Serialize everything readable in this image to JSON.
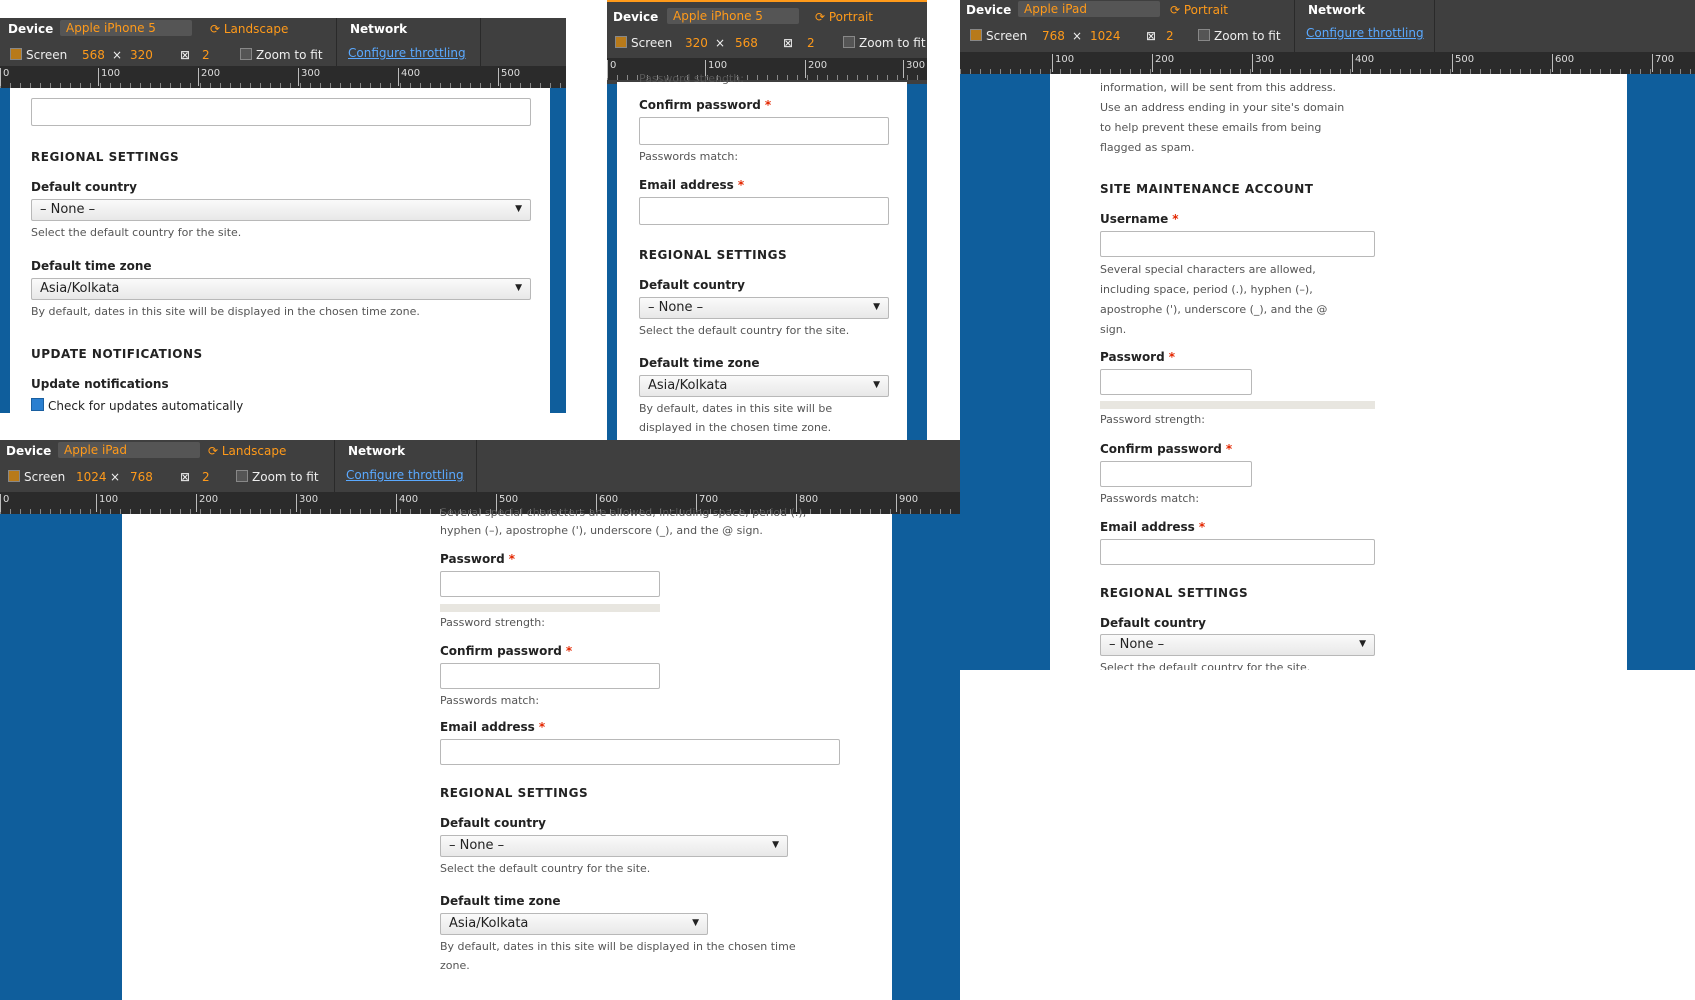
{
  "common": {
    "device_label": "Device",
    "network_label": "Network",
    "screen_label": "Screen",
    "times": "×",
    "zoom_label": "Zoom to fit",
    "throttle_link": "Configure throttling",
    "dpr": "2",
    "rotate_icon": "rotate-icon"
  },
  "p1": {
    "device": "Apple iPhone 5",
    "orientation": "Landscape",
    "w": "568",
    "h": "320",
    "ruler": [
      "0",
      "100",
      "200",
      "300",
      "400",
      "500"
    ],
    "regional": "REGIONAL SETTINGS",
    "country_label": "Default country",
    "country_value": "– None –",
    "country_desc": "Select the default country for the site.",
    "tz_label": "Default time zone",
    "tz_value": "Asia/Kolkata",
    "tz_desc": "By default, dates in this site will be displayed in the chosen time zone.",
    "updates_heading": "UPDATE NOTIFICATIONS",
    "updates_label": "Update notifications",
    "updates_check": "Check for updates automatically"
  },
  "p2": {
    "device": "Apple iPhone 5",
    "orientation": "Portrait",
    "w": "320",
    "h": "568",
    "ruler": [
      "0",
      "100",
      "200",
      "300"
    ],
    "pw_strength": "Password strength:",
    "confirm_label": "Confirm password",
    "match": "Passwords match:",
    "email_label": "Email address",
    "regional": "REGIONAL SETTINGS",
    "country_label": "Default country",
    "country_value": "– None –",
    "country_desc": "Select the default country for the site.",
    "tz_label": "Default time zone",
    "tz_value": "Asia/Kolkata",
    "tz_desc1": "By default, dates in this site will be",
    "tz_desc2": "displayed in the chosen time zone."
  },
  "p3": {
    "device": "Apple iPad",
    "orientation": "Portrait",
    "w": "768",
    "h": "1024",
    "ruler": [
      "100",
      "200",
      "300",
      "400",
      "500",
      "600",
      "700"
    ],
    "info1": "information, will be sent from this address.",
    "info2": "Use an address ending in your site's domain",
    "info3": "to help prevent these emails from being",
    "info4": "flagged as spam.",
    "maint": "SITE MAINTENANCE ACCOUNT",
    "username_label": "Username",
    "uname_desc1": "Several special characters are allowed,",
    "uname_desc2": "including space, period (.), hyphen (–),",
    "uname_desc3": "apostrophe ('), underscore (_), and the @",
    "uname_desc4": "sign.",
    "password_label": "Password",
    "pw_strength": "Password strength:",
    "confirm_label": "Confirm password",
    "match": "Passwords match:",
    "email_label": "Email address",
    "regional": "REGIONAL SETTINGS",
    "country_label": "Default country",
    "country_value": "– None –",
    "country_desc": "Select the default country for the site."
  },
  "p4": {
    "device": "Apple iPad",
    "orientation": "Landscape",
    "w": "1024",
    "h": "768",
    "ruler": [
      "0",
      "100",
      "200",
      "300",
      "400",
      "500",
      "600",
      "700",
      "800",
      "900"
    ],
    "uname_desc1": "Several special characters are allowed, including space, period (.),",
    "uname_desc2": "hyphen (–), apostrophe ('), underscore (_), and the @ sign.",
    "password_label": "Password",
    "pw_strength": "Password strength:",
    "confirm_label": "Confirm password",
    "match": "Passwords match:",
    "email_label": "Email address",
    "regional": "REGIONAL SETTINGS",
    "country_label": "Default country",
    "country_value": "– None –",
    "country_desc": "Select the default country for the site.",
    "tz_label": "Default time zone",
    "tz_value": "Asia/Kolkata",
    "tz_desc1": "By default, dates in this site will be displayed in the chosen time",
    "tz_desc2": "zone."
  }
}
